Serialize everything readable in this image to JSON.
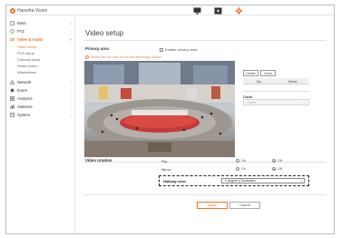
{
  "app": {
    "logo_text": "Hanwha Vision"
  },
  "topbar": {
    "icons": [
      "monitor-icon",
      "playback-icon",
      "settings-gear-icon"
    ]
  },
  "sidebar": {
    "items": [
      {
        "label": "Basic",
        "icon": "basic-icon"
      },
      {
        "label": "PTZ",
        "icon": "ptz-icon"
      },
      {
        "label": "Video & Audio",
        "icon": "video-audio-icon",
        "active": true
      },
      {
        "label": "Network",
        "icon": "network-icon"
      },
      {
        "label": "Event",
        "icon": "event-icon"
      },
      {
        "label": "Analytics",
        "icon": "analytics-icon"
      },
      {
        "label": "Statistics",
        "icon": "statistics-icon"
      },
      {
        "label": "System",
        "icon": "system-icon"
      }
    ],
    "subitems": [
      "Video setup",
      "PVS setup",
      "Camera setup",
      "Smart codec",
      "Wisestream"
    ]
  },
  "page": {
    "title": "Video setup",
    "privacy": {
      "label": "Privacy area",
      "enable_label": "Enable privacy area",
      "hint": "Please set the area on the preview image picture.",
      "delete_label": "Delete",
      "done_label": "Done",
      "table_headers": [
        "No.",
        "Name"
      ],
      "color_label": "Color",
      "color_value": "Green"
    },
    "rotation": {
      "label": "Video rotation",
      "flip_label": "Flip",
      "mirror_label": "Mirror",
      "hallway_label": "Hallway view",
      "on_label": "On",
      "off_label": "Off",
      "flip_value": "Off",
      "mirror_value": "Off",
      "hallway_value": "0 degree (Clockwise)"
    },
    "apply_label": "Apply",
    "cancel_label": "Cancel"
  },
  "colors": {
    "accent": "#f37321",
    "hint": "#e88a3c"
  }
}
